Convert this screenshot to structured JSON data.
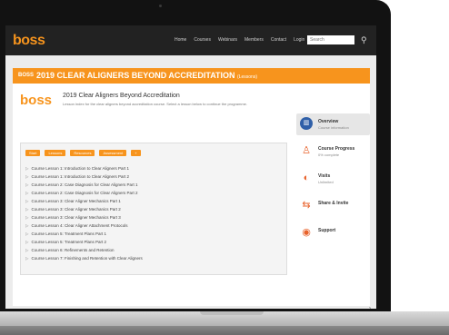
{
  "topnav": {
    "logo": "boss",
    "links": [
      "Home",
      "Courses",
      "Webinars",
      "Members",
      "Contact",
      "Login"
    ],
    "search_placeholder": "Search"
  },
  "banner": {
    "tag": "BOSS",
    "title": "2019 CLEAR ALIGNERS BEYOND ACCREDITATION",
    "subtitle": "(Lessons)"
  },
  "course": {
    "logo": "boss",
    "title": "2019 Clear Aligners Beyond Accreditation",
    "description": "Lesson index for the clear aligners beyond accreditation course. Select a lesson below to continue the programme."
  },
  "pills": [
    "Start",
    "Lessons",
    "Resources",
    "Assessment",
    "+"
  ],
  "lessons": [
    "Course Lesson 1: Introduction to Clear Aligners Part 1",
    "Course Lesson 1: Introduction to Clear Aligners Part 2",
    "Course Lesson 2: Case Diagnosis for Clear Aligners Part 1",
    "Course Lesson 2: Case Diagnosis for Clear Aligners Part 2",
    "Course Lesson 3: Clear Aligner Mechanics Part 1",
    "Course Lesson 3: Clear Aligner Mechanics Part 2",
    "Course Lesson 3: Clear Aligner Mechanics Part 3",
    "Course Lesson 4: Clear Aligner Attachment Protocols",
    "Course Lesson 5: Treatment Plans Part 1",
    "Course Lesson 5: Treatment Plans Part 2",
    "Course Lesson 6: Refinements and Retention",
    "Course Lesson 7: Finishing and Retention with Clear Aligners"
  ],
  "sidebar": {
    "items": [
      {
        "label": "Overview",
        "sub": "Course information",
        "icon": "building-icon"
      },
      {
        "label": "Course Progress",
        "sub": "0% complete",
        "icon": "person-icon"
      },
      {
        "label": "Visits",
        "sub": "Unlimited",
        "icon": "eye-icon"
      },
      {
        "label": "Share & Invite",
        "sub": "",
        "icon": "share-icon"
      },
      {
        "label": "Support",
        "sub": "",
        "icon": "support-icon"
      }
    ]
  },
  "float_button": "›"
}
